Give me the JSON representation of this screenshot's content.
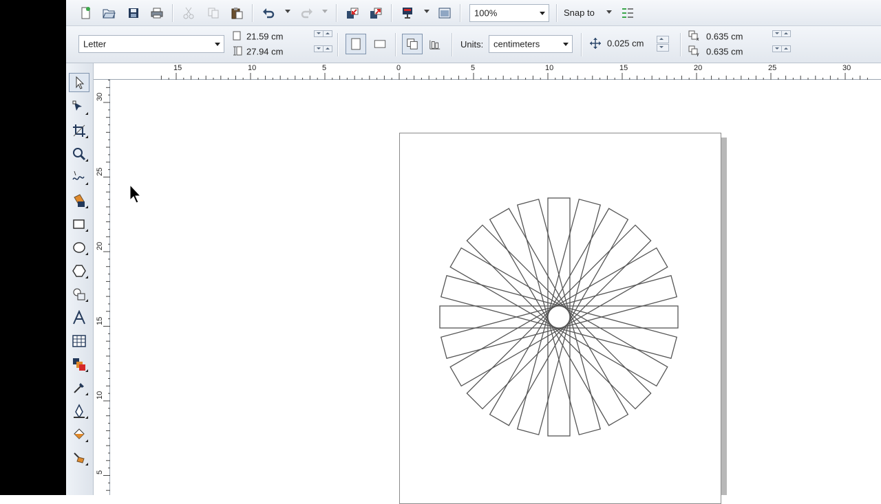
{
  "toolbar": {
    "zoom_value": "100%",
    "snap_label": "Snap to"
  },
  "property_bar": {
    "paper_size": "Letter",
    "page_width": "21.59 cm",
    "page_height": "27.94 cm",
    "units_label": "Units:",
    "units_value": "centimeters",
    "nudge_distance": "0.025 cm",
    "duplicate_x": "0.635 cm",
    "duplicate_y": "0.635 cm"
  },
  "rulers": {
    "horizontal_labels": [
      "15",
      "10",
      "5",
      "0",
      "5",
      "10",
      "15",
      "20",
      "25",
      "30"
    ],
    "vertical_labels": [
      "30",
      "25",
      "20",
      "15",
      "10",
      "5"
    ]
  },
  "drawing": {
    "rectangle_count": 12,
    "rotation_step_deg": 15,
    "stroke_color": "#555555",
    "center_circle": true
  },
  "icons": {
    "new": "new-document-icon",
    "open": "open-folder-icon",
    "save": "save-icon",
    "print": "print-icon",
    "cut": "cut-icon",
    "copy": "copy-icon",
    "paste": "paste-icon",
    "undo": "undo-icon",
    "redo": "redo-icon",
    "import": "import-icon",
    "export": "export-icon",
    "launch": "application-launcher-icon",
    "welcome": "welcome-screen-icon",
    "options": "options-icon"
  }
}
